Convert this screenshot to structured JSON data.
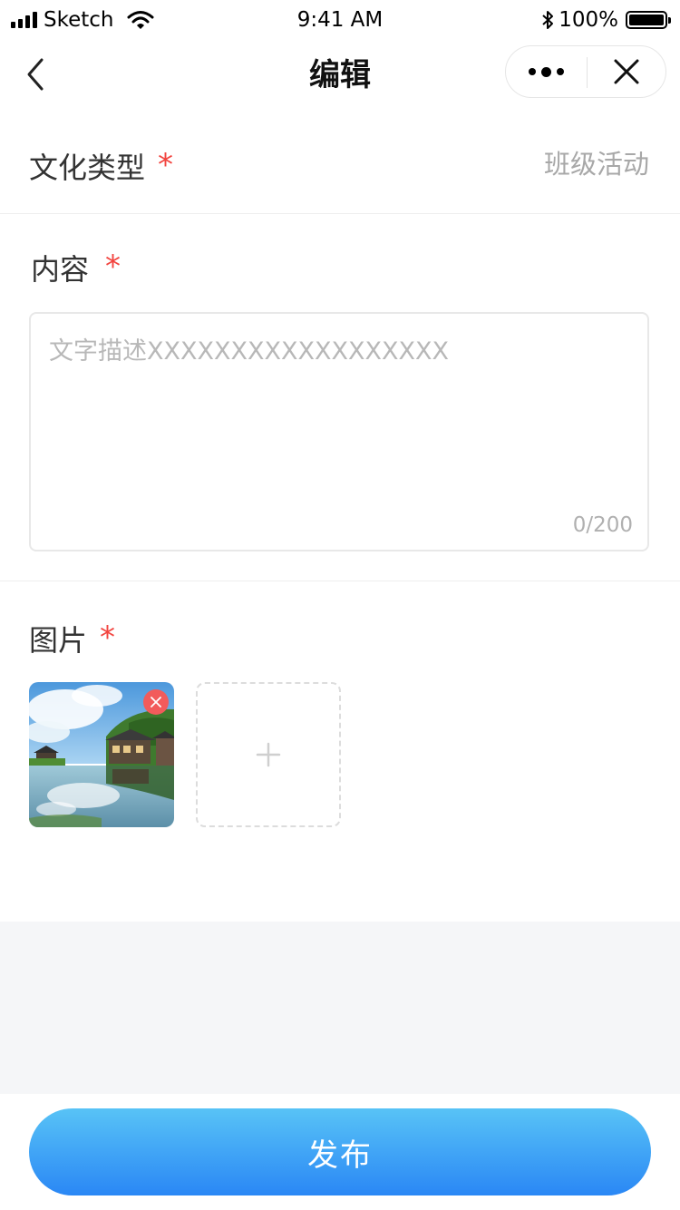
{
  "status_bar": {
    "carrier": "Sketch",
    "time": "9:41 AM",
    "battery_percent": "100%"
  },
  "nav": {
    "title": "编辑"
  },
  "form": {
    "culture_type": {
      "label": "文化类型",
      "required_mark": "*",
      "value": "班级活动"
    },
    "content": {
      "label": "内容",
      "required_mark": "*",
      "placeholder": "文字描述XXXXXXXXXXXXXXXXXX",
      "counter": "0/200"
    },
    "images": {
      "label": "图片",
      "required_mark": "*",
      "count": 1
    }
  },
  "footer": {
    "publish_label": "发布"
  },
  "colors": {
    "required": "#f2443f",
    "button_top": "#58c3f6",
    "button_bottom": "#2a87f5",
    "delete_badge": "#f25b5b",
    "page_gray": "#f5f6f8"
  },
  "icons": [
    "signal-icon",
    "wifi-icon",
    "bluetooth-icon",
    "battery-icon",
    "back-icon",
    "more-icon",
    "close-icon",
    "delete-icon",
    "plus-icon"
  ]
}
